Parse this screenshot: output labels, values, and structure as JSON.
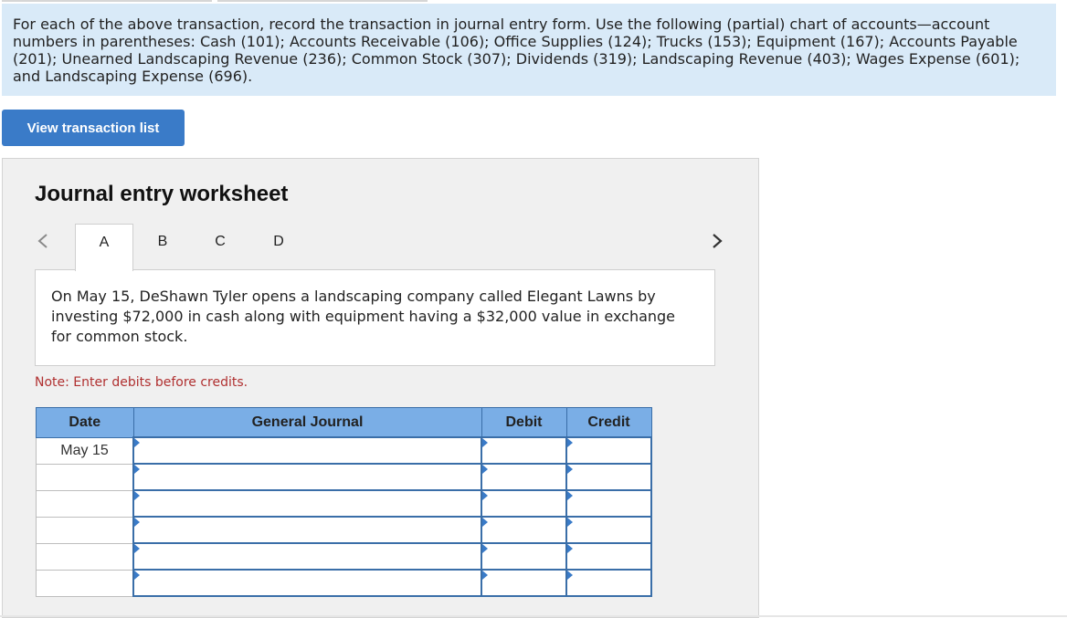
{
  "instructions": "For each of the above transaction, record the transaction in journal entry form. Use the following (partial) chart of accounts—account numbers in parentheses: Cash (101); Accounts Receivable (106); Office Supplies (124); Trucks (153); Equipment (167); Accounts Payable (201); Unearned Landscaping Revenue (236); Common Stock (307); Dividends (319); Landscaping Revenue (403); Wages Expense (601); and Landscaping Expense (696).",
  "view_button": "View transaction list",
  "worksheet": {
    "title": "Journal entry worksheet",
    "tabs": [
      "A",
      "B",
      "C",
      "D"
    ],
    "active_tab": "A",
    "prev_icon": "chevron-left-icon",
    "next_icon": "chevron-right-icon",
    "description": "On May 15, DeShawn Tyler opens a landscaping company called Elegant Lawns by investing $72,000 in cash along with equipment having a $32,000 value in exchange for common stock.",
    "note": "Note: Enter debits before credits."
  },
  "journal": {
    "headers": {
      "date": "Date",
      "general": "General Journal",
      "debit": "Debit",
      "credit": "Credit"
    },
    "rows": [
      {
        "date": "May 15",
        "account": "",
        "debit": "",
        "credit": ""
      },
      {
        "date": "",
        "account": "",
        "debit": "",
        "credit": ""
      },
      {
        "date": "",
        "account": "",
        "debit": "",
        "credit": ""
      },
      {
        "date": "",
        "account": "",
        "debit": "",
        "credit": ""
      },
      {
        "date": "",
        "account": "",
        "debit": "",
        "credit": ""
      },
      {
        "date": "",
        "account": "",
        "debit": "",
        "credit": ""
      }
    ]
  },
  "colors": {
    "instructions_bg": "#d9eaf8",
    "button": "#3a7bc8",
    "header": "#7aaee6",
    "note": "#b03030"
  }
}
